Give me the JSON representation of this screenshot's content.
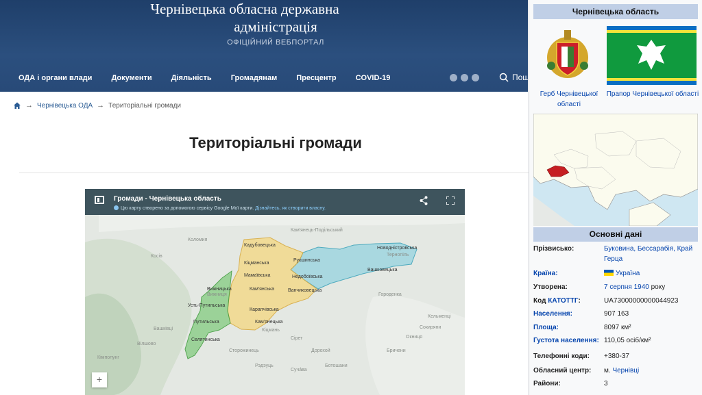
{
  "header": {
    "title_line1": "Чернівецька обласна державна",
    "title_line2": "адміністрація",
    "subtitle": "ОФІЦІЙНИЙ ВЕБПОРТАЛ",
    "search_label": "Пош"
  },
  "nav": {
    "items": [
      {
        "label": "ОДА і органи влади"
      },
      {
        "label": "Документи"
      },
      {
        "label": "Діяльність"
      },
      {
        "label": "Громадянам"
      },
      {
        "label": "Пресцентр"
      },
      {
        "label": "COVID-19"
      }
    ],
    "social_icons": [
      "facebook-icon",
      "telegram-icon",
      "youtube-icon"
    ]
  },
  "breadcrumb": {
    "home_icon": "home-icon",
    "item1": "Чернівецька ОДА",
    "sep": "→",
    "item2": "Територіальні громади"
  },
  "main": {
    "title": "Територіальні громади"
  },
  "map": {
    "title": "Громади - Чернівецька область",
    "info_text": "Цю карту створено за допомогою сервісу Google Мої карти.",
    "info_link": "Дізнайтесь, як створити власну.",
    "zoom_in": "+",
    "base_labels": [
      "Кам'янець-Подільський",
      "Тернопіль",
      "Городенка",
      "Коломия",
      "Косів",
      "Вижниця",
      "Сторожинець",
      "Кельменці",
      "Сокиряни",
      "Окниця",
      "Бричени",
      "Вілшово",
      "Вашківці",
      "Кіцмань",
      "Суча́ва",
      "Рэдэуць",
      "Ботошани",
      "Сірет",
      "Дорохой",
      "Кімполунг"
    ],
    "communities": [
      "Кадубовецька",
      "Мамаївська",
      "Кіцманська",
      "Кам'янська",
      "Вижницька",
      "Усть-Путильська",
      "Путильська",
      "Селятинська",
      "Карапчівська",
      "Кам'янецька",
      "Ванчиковецька",
      "Недобоївська",
      "Рукшинська",
      "Вашковецька",
      "Новодністровська"
    ]
  },
  "infobox": {
    "title": "Чернівецька область",
    "coat_caption": "Герб Чернівецької області",
    "flag_caption": "Прапор Чернівецької області",
    "section": "Основні дані",
    "rows": [
      {
        "key": "Прізвисько:",
        "value": "Буковина, Бессарабія, Край Герца"
      },
      {
        "key": "Країна:",
        "value": "Україна"
      },
      {
        "key": "Утворена:",
        "value_link": "7 серпня 1940",
        "value_rest": " року"
      },
      {
        "key_plain": "Код ",
        "key_link": "КАТОТТГ",
        "key_colon": ":",
        "value": "UA73000000000044923"
      },
      {
        "key": "Населення:",
        "value": "907 163"
      },
      {
        "key": "Площа:",
        "value": "8097 км²"
      },
      {
        "key": "Густота населення:",
        "value": "110,05 осіб/км²"
      },
      {
        "key": "Телефонні коди:",
        "value": "+380-37"
      },
      {
        "key": "Обласний центр:",
        "value_plain": "м. ",
        "value_link": "Чернівці"
      },
      {
        "key": "Райони:",
        "value": "3"
      }
    ]
  },
  "colors": {
    "header_bg": "#24466f",
    "link": "#0645ad",
    "map_bar": "#3e545d",
    "community_green": "#8fcf8c",
    "community_yellow": "#f3d98b",
    "community_blue": "#9fd6e0"
  }
}
